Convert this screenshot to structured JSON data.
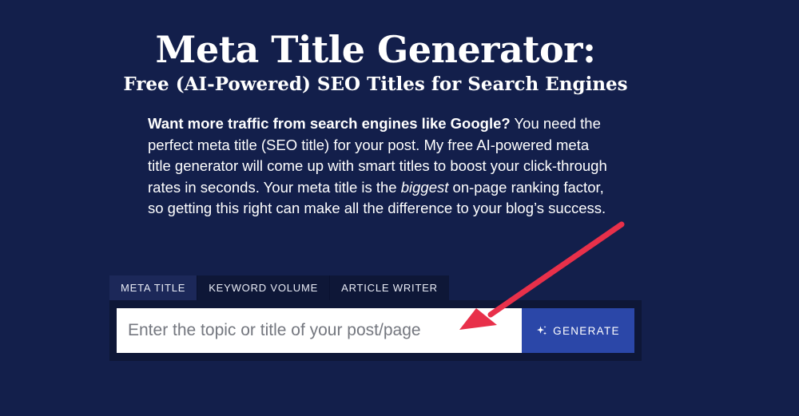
{
  "header": {
    "title": "Meta Title Generator:",
    "subtitle": "Free (AI-Powered) SEO Titles for Search Engines"
  },
  "intro": {
    "lead": "Want more traffic from search engines like Google?",
    "text_1": " You need the perfect meta title (SEO title) for your post. My free AI-powered meta title generator will come up with smart titles to boost your click-through rates in seconds. Your meta title is the ",
    "emphasis": "biggest",
    "text_2": " on-page ranking factor, so getting this right can make all the difference to your blog’s success."
  },
  "tabs": [
    {
      "label": "META TITLE",
      "active": true
    },
    {
      "label": "KEYWORD VOLUME",
      "active": false
    },
    {
      "label": "ARTICLE WRITER",
      "active": false
    }
  ],
  "form": {
    "input_placeholder": "Enter the topic or title of your post/page",
    "input_value": "",
    "button_label": "GENERATE",
    "button_icon": "sparkle-icon"
  },
  "annotation": {
    "icon": "arrow-icon",
    "color": "#e8304a"
  },
  "colors": {
    "background": "#131f4b",
    "panel": "#0e1737",
    "button": "#2b47a8"
  }
}
